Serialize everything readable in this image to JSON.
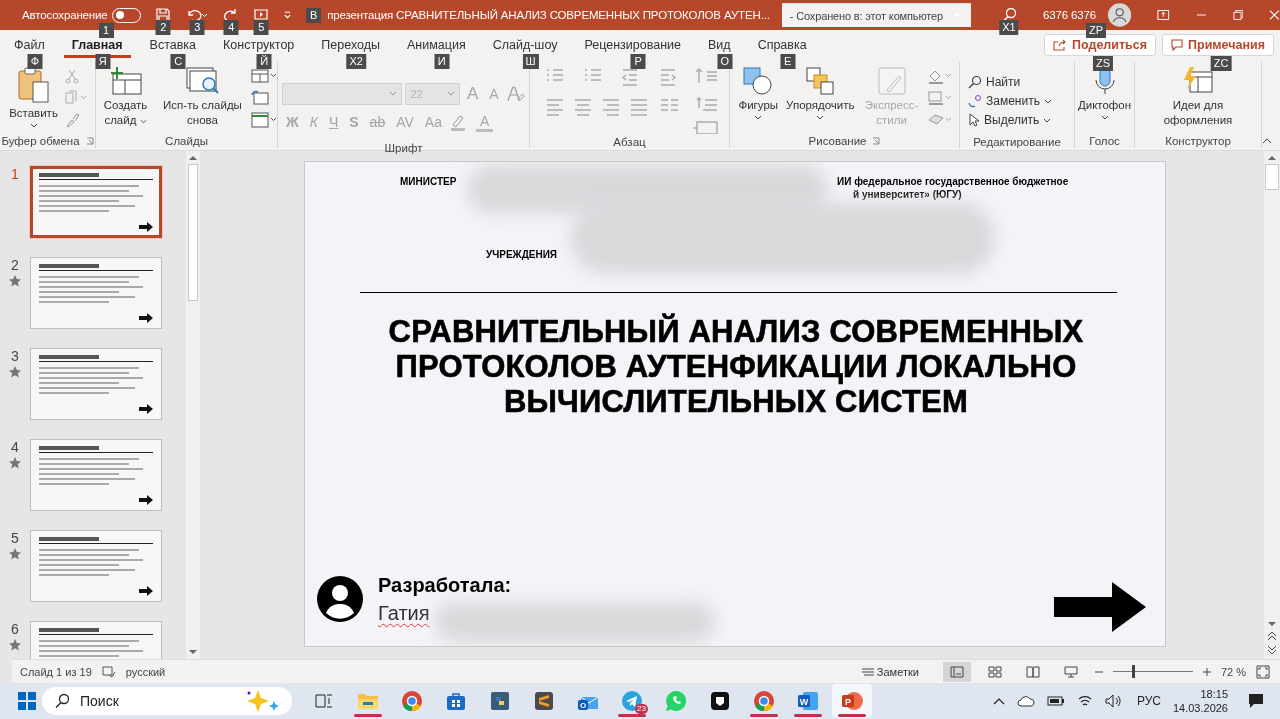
{
  "title_bar": {
    "autosave_label": "Автосохранение",
    "autosave_on": false,
    "autosave_keytip": "1",
    "qat_keytips": [
      "2",
      "3",
      "4",
      "5"
    ],
    "doc_keytip": "В",
    "title": "презентация СРАВНИТЕЛЬНЫЙ АНАЛИЗ СОВРЕМЕННЫХ ПРОТОКОЛОВ АУТЕН...",
    "save_status": "- Сохранено в: этот компьютер",
    "search_keytip": "X1",
    "user": "6376 6376",
    "user_keytip": "ZP"
  },
  "tabs": [
    {
      "label": "Файл",
      "keytip": "Ф",
      "selected": false
    },
    {
      "label": "Главная",
      "keytip": "Я",
      "selected": true
    },
    {
      "label": "Вставка",
      "keytip": "С",
      "selected": false
    },
    {
      "label": "Конструктор",
      "keytip": "Й",
      "selected": false
    },
    {
      "label": "Переходы",
      "keytip": "X2",
      "selected": false
    },
    {
      "label": "Анимация",
      "keytip": "И",
      "selected": false
    },
    {
      "label": "Слайд-шоу",
      "keytip": "Ш",
      "selected": false
    },
    {
      "label": "Рецензирование",
      "keytip": "Р",
      "selected": false
    },
    {
      "label": "Вид",
      "keytip": "О",
      "selected": false
    },
    {
      "label": "Справка",
      "keytip": "Е",
      "selected": false
    }
  ],
  "share": {
    "label": "Поделиться",
    "keytip": "ZS"
  },
  "comments": {
    "label": "Примечания",
    "keytip": "ZC"
  },
  "ribbon": {
    "clipboard": {
      "paste": "Вставить",
      "title": "Буфер обмена"
    },
    "slides": {
      "new_slide": "Создать слайд",
      "reuse": "Исп-ть слайды снова",
      "title": "Слайды"
    },
    "font": {
      "size": "22",
      "grow": "A",
      "shrink": "A",
      "bold": "Ж",
      "italic": "К",
      "underline": "Ч",
      "shadow": "S",
      "strike": "ab",
      "spacing": "AV",
      "case": "Aa",
      "font_color": "A",
      "title": "Шрифт",
      "disabled": true
    },
    "paragraph": {
      "title": "Абзац"
    },
    "drawing": {
      "shapes": "Фигуры",
      "arrange": "Упорядочить",
      "quick_styles": "Экспресс-стили",
      "quick_styles_disabled": true,
      "title": "Рисование"
    },
    "editing": {
      "find": "Найти",
      "replace": "Заменить",
      "select": "Выделить",
      "title": "Редактирование"
    },
    "voice": {
      "dictate": "Диктофон",
      "title": "Голос"
    },
    "designer": {
      "ideas": "Идеи для оформления",
      "title": "Конструктор"
    }
  },
  "thumbnails": [
    {
      "number": "1",
      "selected": true,
      "animated": false
    },
    {
      "number": "2",
      "selected": false,
      "animated": true
    },
    {
      "number": "3",
      "selected": false,
      "animated": true
    },
    {
      "number": "4",
      "selected": false,
      "animated": true
    },
    {
      "number": "5",
      "selected": false,
      "animated": true
    },
    {
      "number": "6",
      "selected": false,
      "animated": true
    }
  ],
  "slide": {
    "header_left": "МИНИСТЕР",
    "header_right_1": "ИИ федеральное государственное бюджетное",
    "header_right_2": "й университет» (ЮГУ)",
    "institution": "УЧРЕЖДЕНИЯ",
    "title": "СРАВНИТЕЛЬНЫЙ АНАЛИЗ СОВРЕМЕННЫХ ПРОТОКОЛОВ АУТЕНФИКАЦИИ ЛОКАЛЬНО ВЫЧИСЛИТЕЛЬНЫХ СИСТЕМ",
    "developer_label": "Разработала:",
    "developer_name": "Гатия",
    "name_misspelled": true
  },
  "status_bar": {
    "slide_counter": "Слайд 1 из 19",
    "language": "русский",
    "notes": "Заметки",
    "views": [
      {
        "kind": "normal",
        "selected": true
      },
      {
        "kind": "sorter",
        "selected": false
      },
      {
        "kind": "reading",
        "selected": false
      },
      {
        "kind": "slideshow",
        "selected": false
      }
    ],
    "zoom": {
      "level": 0.25,
      "reading": "72 %"
    }
  },
  "taskbar": {
    "search_placeholder": "Поиск",
    "apps": [
      {
        "kind": "taskview",
        "running": false,
        "active": false
      },
      {
        "kind": "folder",
        "running": true,
        "active": false
      },
      {
        "kind": "browser",
        "running": false,
        "active": false
      },
      {
        "kind": "store",
        "running": false,
        "active": false
      },
      {
        "kind": "python",
        "running": false,
        "active": false
      },
      {
        "kind": "editor",
        "running": false,
        "active": false
      },
      {
        "kind": "mail",
        "glyph": "O",
        "running": false,
        "active": false
      },
      {
        "kind": "messenger",
        "badge": "23",
        "running": true,
        "active": false
      },
      {
        "kind": "chat",
        "running": false,
        "active": false
      },
      {
        "kind": "dark",
        "running": false,
        "active": false
      },
      {
        "kind": "browser",
        "running": true,
        "active": false
      },
      {
        "kind": "word",
        "glyph": "W",
        "running": true,
        "active": false
      },
      {
        "kind": "slides",
        "glyph": "P",
        "running": true,
        "active": true
      }
    ],
    "language": "РУС",
    "time": "18:15",
    "date": "14.03.2026"
  }
}
